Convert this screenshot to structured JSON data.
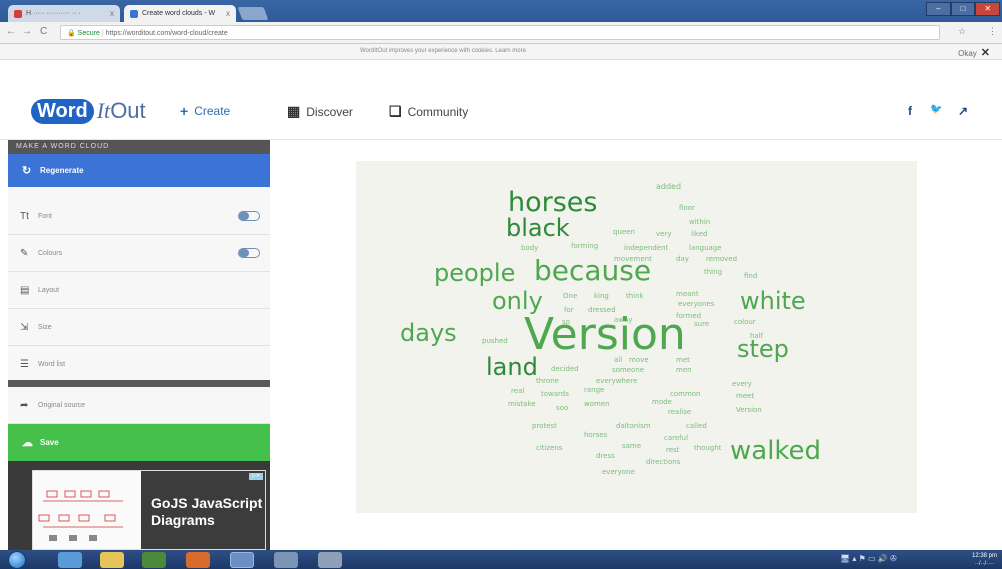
{
  "browser": {
    "tabs": [
      {
        "label": "H ····· ·········· ·· ·",
        "active": false,
        "favicon_color": "#d93a3a"
      },
      {
        "label": "Create word clouds - W",
        "active": true,
        "favicon_color": "#3b73d6"
      }
    ],
    "tab_close": "x",
    "nav": {
      "back": "←",
      "forward": "→",
      "reload": "C"
    },
    "address": {
      "secure": "Secure",
      "url": "https://worditout.com/word-cloud/create"
    },
    "address_icons": [
      "☆",
      "⋮"
    ],
    "window_controls": [
      "–",
      "□",
      "✕"
    ]
  },
  "cookie_bar": {
    "message": "WordItOut improves your experience with cookies. Learn more",
    "ok_label": "Okay",
    "close": "✕"
  },
  "site": {
    "logo": {
      "word": "Word",
      "it": "It",
      "out": "Out"
    },
    "nav": {
      "create": {
        "label": "Create",
        "icon": "+"
      },
      "discover": {
        "label": "Discover",
        "icon": "▦"
      },
      "community": {
        "label": "Community",
        "icon": "❏"
      }
    },
    "social": {
      "facebook": "f",
      "twitter": "🐦",
      "share": "↗"
    }
  },
  "sidebar": {
    "title": "MAKE A WORD CLOUD",
    "regenerate": {
      "label": "Regenerate",
      "icon": "↻"
    },
    "items": [
      {
        "label": "Font",
        "icon": "Tt",
        "toggle": true
      },
      {
        "label": "Colours",
        "icon": "✎",
        "toggle": true
      },
      {
        "label": "Layout",
        "icon": "▤",
        "toggle": false
      },
      {
        "label": "Size",
        "icon": "⇲",
        "toggle": false
      },
      {
        "label": "Word list",
        "icon": "☰",
        "toggle": false
      }
    ],
    "original_source": {
      "label": "Original source",
      "icon": "➦"
    },
    "save": {
      "label": "Save",
      "icon": "☁"
    }
  },
  "ad": {
    "headline": "GoJS JavaScript Diagrams",
    "badge": "▷✕"
  },
  "word_cloud": {
    "words": [
      {
        "text": "added",
        "size": 8,
        "tone": "l"
      },
      {
        "text": "horses",
        "size": 27,
        "tone": "d"
      },
      {
        "text": "floor",
        "size": 7,
        "tone": "l"
      },
      {
        "text": "within",
        "size": 7,
        "tone": "l"
      },
      {
        "text": "black",
        "size": 24,
        "tone": "d"
      },
      {
        "text": "queen",
        "size": 7,
        "tone": "l"
      },
      {
        "text": "very",
        "size": 7,
        "tone": "l"
      },
      {
        "text": "liked",
        "size": 7,
        "tone": "l"
      },
      {
        "text": "body",
        "size": 7,
        "tone": "l"
      },
      {
        "text": "forming",
        "size": 7,
        "tone": "l"
      },
      {
        "text": "independent",
        "size": 7,
        "tone": "l"
      },
      {
        "text": "language",
        "size": 7,
        "tone": "l"
      },
      {
        "text": "movement",
        "size": 7,
        "tone": "l"
      },
      {
        "text": "day",
        "size": 7,
        "tone": "l"
      },
      {
        "text": "removed",
        "size": 7,
        "tone": "l"
      },
      {
        "text": "people",
        "size": 24,
        "tone": "m"
      },
      {
        "text": "because",
        "size": 28,
        "tone": "m"
      },
      {
        "text": "thing",
        "size": 7,
        "tone": "l"
      },
      {
        "text": "find",
        "size": 7,
        "tone": "l"
      },
      {
        "text": "only",
        "size": 24,
        "tone": "m"
      },
      {
        "text": "One",
        "size": 7,
        "tone": "l"
      },
      {
        "text": "king",
        "size": 7,
        "tone": "l"
      },
      {
        "text": "think",
        "size": 7,
        "tone": "l"
      },
      {
        "text": "meant",
        "size": 7,
        "tone": "l"
      },
      {
        "text": "everyones",
        "size": 7,
        "tone": "l"
      },
      {
        "text": "white",
        "size": 24,
        "tone": "m"
      },
      {
        "text": "for",
        "size": 7,
        "tone": "l"
      },
      {
        "text": "dressed",
        "size": 7,
        "tone": "l"
      },
      {
        "text": "formed",
        "size": 7,
        "tone": "l"
      },
      {
        "text": "colour",
        "size": 7,
        "tone": "l"
      },
      {
        "text": "so",
        "size": 7,
        "tone": "l"
      },
      {
        "text": "away",
        "size": 7,
        "tone": "l"
      },
      {
        "text": "sure",
        "size": 7,
        "tone": "l"
      },
      {
        "text": "days",
        "size": 24,
        "tone": "m"
      },
      {
        "text": "pushed",
        "size": 7,
        "tone": "l"
      },
      {
        "text": "Version",
        "size": 44,
        "tone": "m"
      },
      {
        "text": "half",
        "size": 7,
        "tone": "l"
      },
      {
        "text": "step",
        "size": 24,
        "tone": "m"
      },
      {
        "text": "all",
        "size": 7,
        "tone": "l"
      },
      {
        "text": "move",
        "size": 7,
        "tone": "l"
      },
      {
        "text": "met",
        "size": 7,
        "tone": "l"
      },
      {
        "text": "land",
        "size": 24,
        "tone": "d"
      },
      {
        "text": "decided",
        "size": 7,
        "tone": "l"
      },
      {
        "text": "someone",
        "size": 7,
        "tone": "l"
      },
      {
        "text": "men",
        "size": 7,
        "tone": "l"
      },
      {
        "text": "throne",
        "size": 7,
        "tone": "l"
      },
      {
        "text": "everywhere",
        "size": 7,
        "tone": "l"
      },
      {
        "text": "every",
        "size": 7,
        "tone": "l"
      },
      {
        "text": "real",
        "size": 7,
        "tone": "l"
      },
      {
        "text": "towards",
        "size": 7,
        "tone": "l"
      },
      {
        "text": "range",
        "size": 7,
        "tone": "l"
      },
      {
        "text": "common",
        "size": 7,
        "tone": "l"
      },
      {
        "text": "meet",
        "size": 7,
        "tone": "l"
      },
      {
        "text": "mistake",
        "size": 7,
        "tone": "l"
      },
      {
        "text": "mode",
        "size": 7,
        "tone": "l"
      },
      {
        "text": "soo",
        "size": 7,
        "tone": "l"
      },
      {
        "text": "women",
        "size": 7,
        "tone": "l"
      },
      {
        "text": "realise",
        "size": 7,
        "tone": "l"
      },
      {
        "text": "Version",
        "size": 7,
        "tone": "l"
      },
      {
        "text": "protest",
        "size": 7,
        "tone": "l"
      },
      {
        "text": "daltonism",
        "size": 7,
        "tone": "l"
      },
      {
        "text": "called",
        "size": 7,
        "tone": "l"
      },
      {
        "text": "horses",
        "size": 7,
        "tone": "l"
      },
      {
        "text": "careful",
        "size": 7,
        "tone": "l"
      },
      {
        "text": "citizens",
        "size": 7,
        "tone": "l"
      },
      {
        "text": "same",
        "size": 7,
        "tone": "l"
      },
      {
        "text": "dress",
        "size": 7,
        "tone": "l"
      },
      {
        "text": "rest",
        "size": 7,
        "tone": "l"
      },
      {
        "text": "thought",
        "size": 7,
        "tone": "l"
      },
      {
        "text": "walked",
        "size": 26,
        "tone": "m"
      },
      {
        "text": "directions",
        "size": 7,
        "tone": "l"
      },
      {
        "text": "everyone",
        "size": 7,
        "tone": "l"
      }
    ]
  },
  "taskbar": {
    "tray": "🖥 ▴ ⚑ ▭ 🔊 ✇",
    "time": "12:38 pm",
    "date": "··/··/····"
  }
}
